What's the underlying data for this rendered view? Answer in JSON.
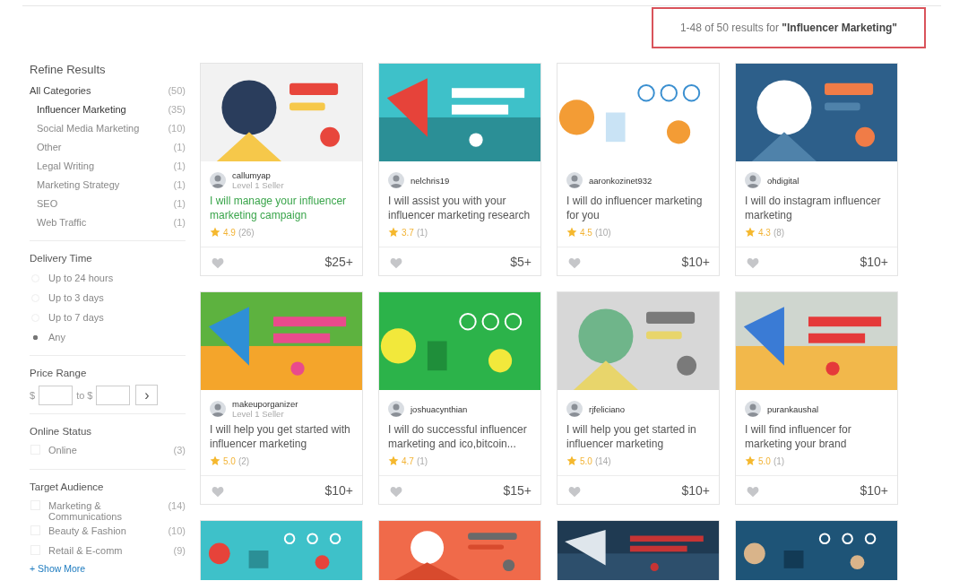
{
  "results_summary": {
    "range": "1-48 of 50 results for",
    "query": "\"Influencer Marketing\""
  },
  "sidebar": {
    "title": "Refine Results",
    "categories": [
      {
        "label": "All Categories",
        "count": "(50)",
        "selected": false,
        "children": [
          {
            "label": "Influencer Marketing",
            "count": "(35)",
            "selected": true
          },
          {
            "label": "Social Media Marketing",
            "count": "(10)",
            "selected": false
          },
          {
            "label": "Other",
            "count": "(1)",
            "selected": false
          },
          {
            "label": "Legal Writing",
            "count": "(1)",
            "selected": false
          },
          {
            "label": "Marketing Strategy",
            "count": "(1)",
            "selected": false
          },
          {
            "label": "SEO",
            "count": "(1)",
            "selected": false
          },
          {
            "label": "Web Traffic",
            "count": "(1)",
            "selected": false
          }
        ]
      }
    ],
    "delivery_time": {
      "title": "Delivery Time",
      "options": [
        {
          "label": "Up to 24 hours",
          "selected": false
        },
        {
          "label": "Up to 3 days",
          "selected": false
        },
        {
          "label": "Up to 7 days",
          "selected": false
        },
        {
          "label": "Any",
          "selected": true
        }
      ]
    },
    "price_range": {
      "title": "Price Range",
      "min_prefix": "$",
      "max_prefix": "to $",
      "go": "›"
    },
    "online_status": {
      "title": "Online Status",
      "options": [
        {
          "label": "Online",
          "count": "(3)",
          "checked": false
        }
      ]
    },
    "target_audience": {
      "title": "Target Audience",
      "options": [
        {
          "label": "Marketing & Communications",
          "count": "(14)",
          "checked": false
        },
        {
          "label": "Beauty & Fashion",
          "count": "(10)",
          "checked": false
        },
        {
          "label": "Retail & E-comm",
          "count": "(9)",
          "checked": false
        }
      ],
      "show_more": "+ Show More"
    }
  },
  "gigs": [
    {
      "seller": "callumyap",
      "level": "Level 1 Seller",
      "title": "I will manage your influencer marketing campaign",
      "highlighted": true,
      "rating": "4.9",
      "reviews": "(26)",
      "price": "$25+"
    },
    {
      "seller": "nelchris19",
      "title": "I will assist you with your influencer marketing research",
      "highlighted": false,
      "rating": "3.7",
      "reviews": "(1)",
      "price": "$5+"
    },
    {
      "seller": "aaronkozinet932",
      "title": "I will do influencer marketing for you",
      "highlighted": false,
      "rating": "4.5",
      "reviews": "(10)",
      "price": "$10+"
    },
    {
      "seller": "ohdigital",
      "title": "I will do instagram influencer marketing",
      "highlighted": false,
      "rating": "4.3",
      "reviews": "(8)",
      "price": "$10+"
    },
    {
      "seller": "makeuporganizer",
      "level": "Level 1 Seller",
      "title": "I will help you get started with influencer marketing",
      "highlighted": false,
      "rating": "5.0",
      "reviews": "(2)",
      "price": "$10+"
    },
    {
      "seller": "joshuacynthian",
      "title": "I will do successful influencer marketing and ico,bitcoin...",
      "highlighted": false,
      "rating": "4.7",
      "reviews": "(1)",
      "price": "$15+"
    },
    {
      "seller": "rjfeliciano",
      "title": "I will help you get started in influencer marketing",
      "highlighted": false,
      "rating": "5.0",
      "reviews": "(14)",
      "price": "$10+"
    },
    {
      "seller": "purankaushal",
      "title": "I will find influencer for marketing your brand",
      "highlighted": false,
      "rating": "5.0",
      "reviews": "(1)",
      "price": "$10+"
    },
    {
      "kind": "picture"
    },
    {
      "kind": "picture"
    },
    {
      "kind": "picture"
    },
    {
      "kind": "picture"
    }
  ]
}
